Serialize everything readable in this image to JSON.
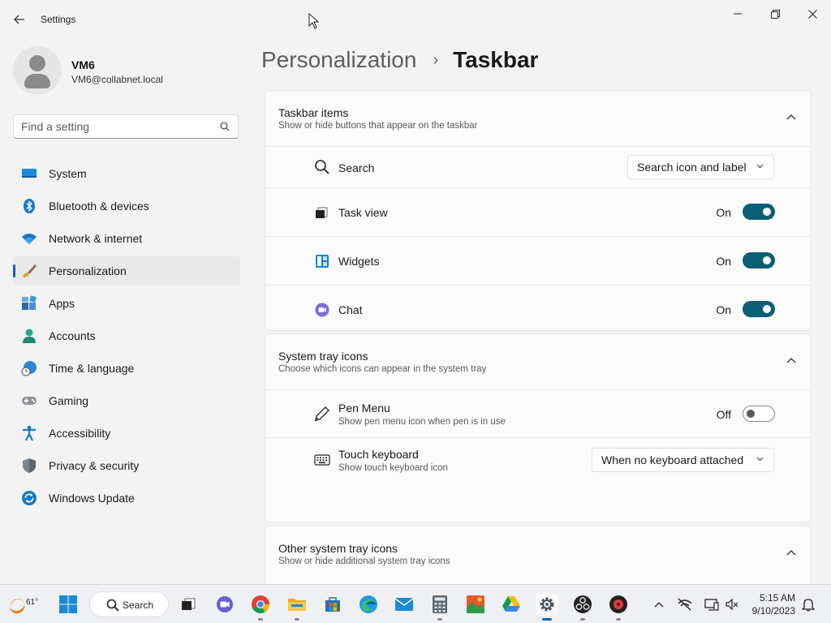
{
  "window": {
    "title": "Settings",
    "back_icon": "back-arrow-icon",
    "controls": [
      "minimize-icon",
      "restore-icon",
      "close-icon"
    ]
  },
  "user": {
    "name": "VM6",
    "email": "VM6@collabnet.local"
  },
  "search": {
    "placeholder": "Find a setting",
    "value": ""
  },
  "sidebar": {
    "items": [
      {
        "label": "System",
        "icon": "system-icon"
      },
      {
        "label": "Bluetooth & devices",
        "icon": "bluetooth-icon"
      },
      {
        "label": "Network & internet",
        "icon": "wifi-icon"
      },
      {
        "label": "Personalization",
        "icon": "brush-icon",
        "active": true
      },
      {
        "label": "Apps",
        "icon": "apps-icon"
      },
      {
        "label": "Accounts",
        "icon": "accounts-icon"
      },
      {
        "label": "Time & language",
        "icon": "time-language-icon"
      },
      {
        "label": "Gaming",
        "icon": "gamepad-icon"
      },
      {
        "label": "Accessibility",
        "icon": "accessibility-icon"
      },
      {
        "label": "Privacy & security",
        "icon": "shield-icon"
      },
      {
        "label": "Windows Update",
        "icon": "update-icon"
      }
    ]
  },
  "header": {
    "parent": "Personalization",
    "separator": "›",
    "current": "Taskbar"
  },
  "taskbar_items": {
    "title": "Taskbar items",
    "subtitle": "Show or hide buttons that appear on the taskbar",
    "rows": {
      "search": {
        "label": "Search",
        "value": "Search icon and label"
      },
      "task_view": {
        "label": "Task view",
        "state": "On"
      },
      "widgets": {
        "label": "Widgets",
        "state": "On"
      },
      "chat": {
        "label": "Chat",
        "state": "On"
      }
    }
  },
  "system_tray": {
    "title": "System tray icons",
    "subtitle": "Choose which icons can appear in the system tray",
    "rows": {
      "pen": {
        "label": "Pen Menu",
        "sub": "Show pen menu icon when pen is in use",
        "state": "Off"
      },
      "keyboard": {
        "label": "Touch keyboard",
        "sub": "Show touch keyboard icon",
        "value": "When no keyboard attached"
      }
    }
  },
  "other_tray": {
    "title": "Other system tray icons",
    "subtitle": "Show or hide additional system tray icons"
  },
  "taskbar": {
    "weather_temp": "61°",
    "search_label": "Search",
    "apps": [
      "start-icon",
      "task-view-icon",
      "teams-chat-icon",
      "chrome-icon",
      "file-explorer-icon",
      "store-icon",
      "edge-icon",
      "mail-icon",
      "calculator-icon",
      "photos-icon",
      "google-drive-icon",
      "settings-icon",
      "obs-icon",
      "media-icon"
    ],
    "tray": [
      "chevron-up-icon",
      "network-off-icon",
      "display-icon",
      "volume-muted-icon",
      "notification-bell-icon"
    ],
    "time": "5:15 AM",
    "date": "9/10/2023"
  },
  "colors": {
    "accent": "#0067c0",
    "toggle_on": "#0b5f74",
    "background": "#f3f3f3"
  }
}
